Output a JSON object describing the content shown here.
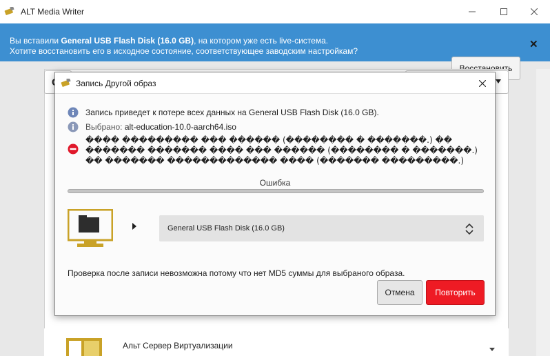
{
  "window": {
    "title": "ALT Media Writer"
  },
  "banner": {
    "line1_prefix": "Вы вставили ",
    "line1_bold": "General USB Flash Disk (16.0 GB)",
    "line1_suffix": ", на котором уже есть live-система.",
    "line2": "Хотите восстановить его в исходное состояние, соответствующее заводским настройкам?",
    "restore_label": "Восстановить",
    "dismiss_label": "✕",
    "background_color": "#3d8fd1"
  },
  "background": {
    "combo_left_text": "G",
    "list_item": "Альт Сервер Виртуализации"
  },
  "dialog": {
    "title": "Запись Другой образ",
    "messages": {
      "warning": "Запись приведет к потере всех данных на General USB Flash Disk (16.0 GB).",
      "selected_label": "Выбрано: ",
      "selected_file": "alt-education-10.0-aarch64.iso",
      "error_lines": [
        "���� ��������� ��� ������ (�������� � �������.) ��",
        "������� ������� ���� ��� ������ (�������� � �������.)",
        "�� ������� ������������� ���� (������� ���������.)"
      ]
    },
    "progress": {
      "label": "Ошибка",
      "value": 0
    },
    "drive_select": {
      "value": "General USB Flash Disk (16.0 GB)"
    },
    "verify_note": "Проверка после записи невозможна потому что нет MD5 суммы для выбраного образа.",
    "buttons": {
      "cancel": "Отмена",
      "retry": "Повторить"
    },
    "colors": {
      "retry": "#ee1b24",
      "info_icon": "#6e86b8",
      "error_icon": "#e0182a",
      "drive_icon": "#c9a227"
    }
  }
}
